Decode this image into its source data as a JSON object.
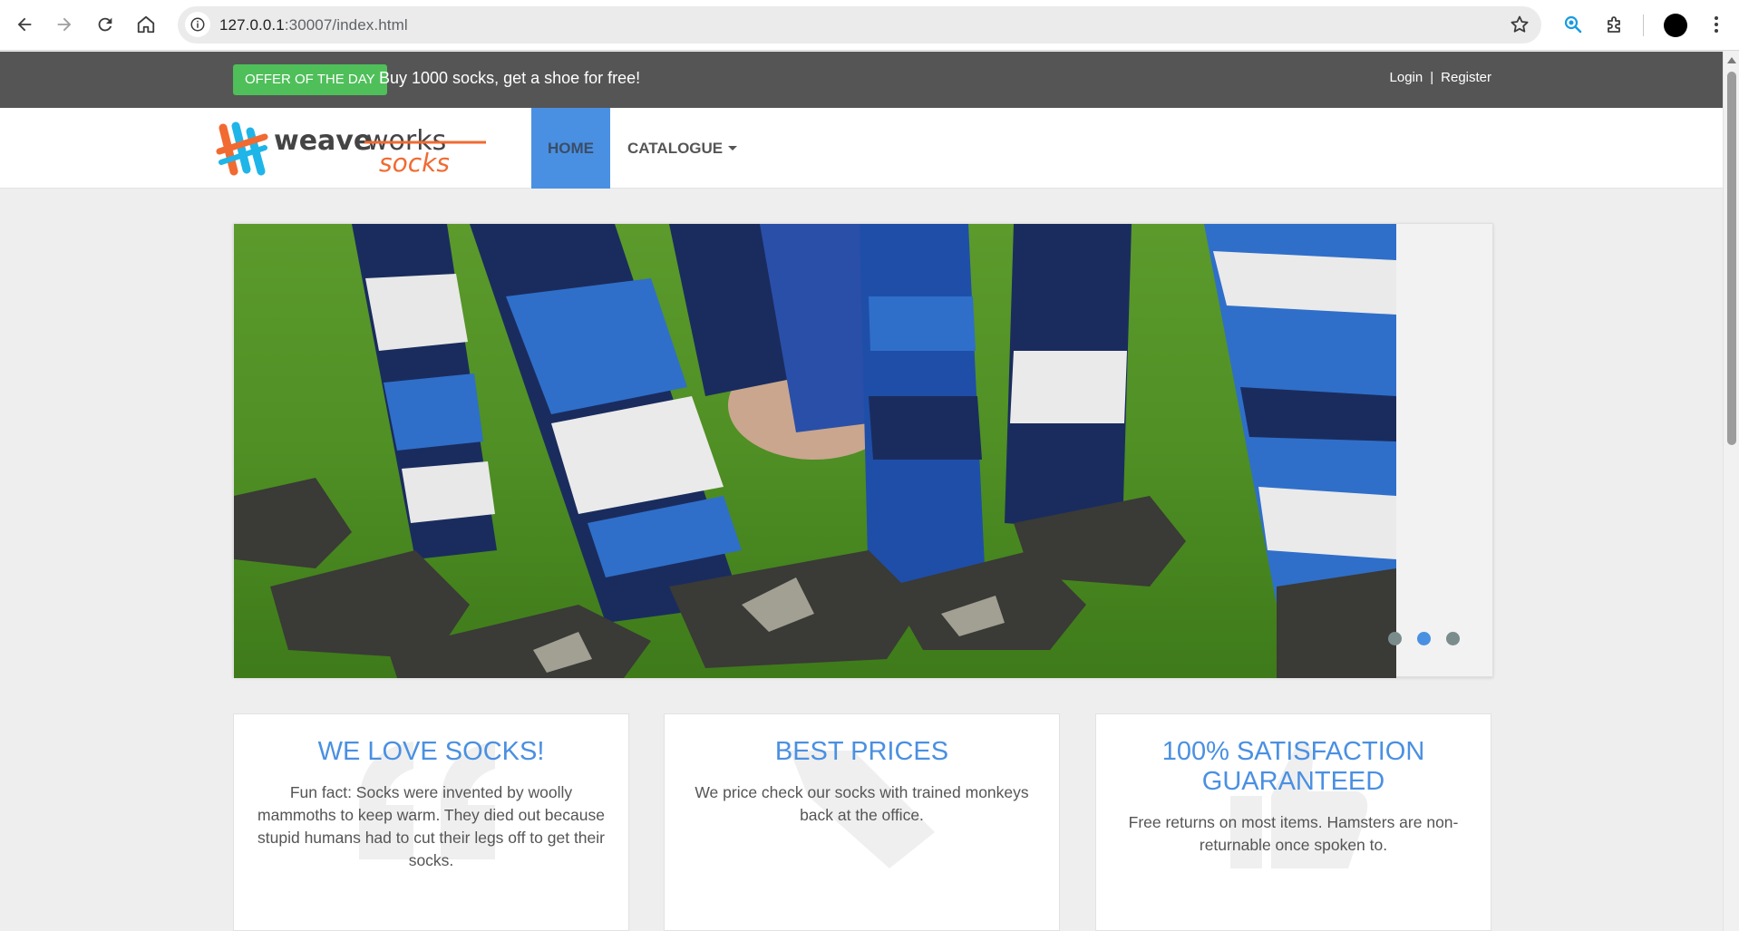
{
  "browser": {
    "url_host": "127.0.0.1",
    "url_rest": ":30007/index.html"
  },
  "topbar": {
    "offer_badge": "OFFER OF THE DAY",
    "offer_text": "Buy 1000 socks, get a shoe for free!",
    "login": "Login",
    "separator": "|",
    "register": "Register"
  },
  "nav": {
    "logo_alt": "weaveworks socks",
    "home": "HOME",
    "catalogue": "CATALOGUE"
  },
  "carousel": {
    "slide_count": 3,
    "active_index": 1
  },
  "features": [
    {
      "title": "WE LOVE SOCKS!",
      "text": "Fun fact: Socks were invented by woolly mammoths to keep warm. They died out because stupid humans had to cut their legs off to get their socks.",
      "icon": "quote-icon"
    },
    {
      "title": "BEST PRICES",
      "text": "We price check our socks with trained monkeys back at the office.",
      "icon": "tag-icon"
    },
    {
      "title": "100% SATISFACTION GUARANTEED",
      "text": "Free returns on most items. Hamsters are non-returnable once spoken to.",
      "icon": "thumbs-up-icon"
    }
  ],
  "colors": {
    "accent": "#4a90e2",
    "offer_green": "#4fbf5a",
    "topbar": "#555555"
  }
}
